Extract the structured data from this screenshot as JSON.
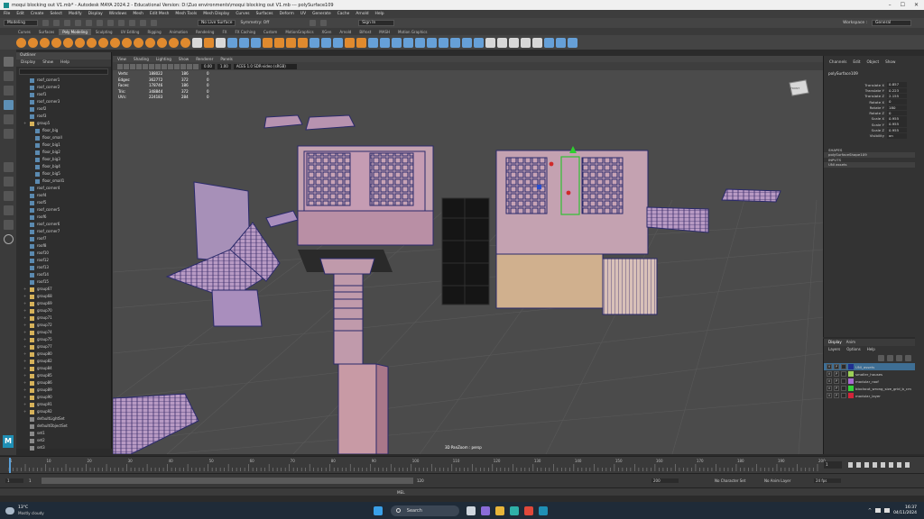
{
  "window": {
    "title": "moqui blocking out V1.mb* - Autodesk MAYA 2024.2 - Educational Version: D:\\Zuo environments\\moqui blocking out V1.mb   ---   polySurface109"
  },
  "menubar": [
    "File",
    "Edit",
    "Create",
    "Select",
    "Modify",
    "Display",
    "Windows",
    "Mesh",
    "Edit Mesh",
    "Mesh Tools",
    "Mesh Display",
    "Curves",
    "Surfaces",
    "Deform",
    "UV",
    "Generate",
    "Cache",
    "Arnold",
    "Help"
  ],
  "statusline": {
    "mode": "Modeling",
    "live_surface": "No Live Surface",
    "symmetry": "Symmetry: Off",
    "signin": "Sign In",
    "workspace_label": "Workspace :",
    "workspace": "General"
  },
  "shelf": {
    "tabs": [
      "Curves",
      "Surfaces",
      "Poly Modeling",
      "Sculpting",
      "UV Editing",
      "Rigging",
      "Animation",
      "Rendering",
      "FX",
      "FX Caching",
      "Custom",
      "MotionGraphics",
      "XGen",
      "Arnold",
      "Bifrost",
      "MASH",
      "Motion Graphics"
    ],
    "active_tab": "Poly Modeling"
  },
  "outliner": {
    "title": "Outliner",
    "menu": [
      "Display",
      "Show",
      "Help"
    ],
    "items": [
      {
        "name": "roof_corner1",
        "type": "mesh"
      },
      {
        "name": "roof_corner2",
        "type": "mesh"
      },
      {
        "name": "roof1",
        "type": "mesh"
      },
      {
        "name": "roof_corner3",
        "type": "mesh"
      },
      {
        "name": "roof2",
        "type": "mesh"
      },
      {
        "name": "roof3",
        "type": "mesh"
      },
      {
        "name": "group5",
        "type": "group"
      },
      {
        "name": "floor_big",
        "type": "mesh"
      },
      {
        "name": "floor_small",
        "type": "mesh"
      },
      {
        "name": "floor_big1",
        "type": "mesh"
      },
      {
        "name": "floor_big2",
        "type": "mesh"
      },
      {
        "name": "floor_big3",
        "type": "mesh"
      },
      {
        "name": "floor_big4",
        "type": "mesh"
      },
      {
        "name": "floor_big5",
        "type": "mesh"
      },
      {
        "name": "floor_small1",
        "type": "mesh"
      },
      {
        "name": "roof_corner4",
        "type": "mesh"
      },
      {
        "name": "roof4",
        "type": "mesh"
      },
      {
        "name": "roof5",
        "type": "mesh"
      },
      {
        "name": "roof_corner5",
        "type": "mesh"
      },
      {
        "name": "roof6",
        "type": "mesh"
      },
      {
        "name": "roof_corner6",
        "type": "mesh"
      },
      {
        "name": "roof_corner7",
        "type": "mesh"
      },
      {
        "name": "roof7",
        "type": "mesh"
      },
      {
        "name": "roof8",
        "type": "mesh"
      },
      {
        "name": "roof10",
        "type": "mesh"
      },
      {
        "name": "roof12",
        "type": "mesh"
      },
      {
        "name": "roof13",
        "type": "mesh"
      },
      {
        "name": "roof14",
        "type": "mesh"
      },
      {
        "name": "roof15",
        "type": "mesh"
      },
      {
        "name": "group67",
        "type": "group"
      },
      {
        "name": "group68",
        "type": "group"
      },
      {
        "name": "group69",
        "type": "group"
      },
      {
        "name": "group70",
        "type": "group"
      },
      {
        "name": "group71",
        "type": "group"
      },
      {
        "name": "group72",
        "type": "group"
      },
      {
        "name": "group74",
        "type": "group"
      },
      {
        "name": "group75",
        "type": "group"
      },
      {
        "name": "group77",
        "type": "group"
      },
      {
        "name": "group80",
        "type": "group"
      },
      {
        "name": "group82",
        "type": "group"
      },
      {
        "name": "group84",
        "type": "group"
      },
      {
        "name": "group85",
        "type": "group"
      },
      {
        "name": "group86",
        "type": "group"
      },
      {
        "name": "group89",
        "type": "group"
      },
      {
        "name": "group90",
        "type": "group"
      },
      {
        "name": "group91",
        "type": "group"
      },
      {
        "name": "group92",
        "type": "group"
      },
      {
        "name": "defaultLightSet",
        "type": "set"
      },
      {
        "name": "defaultObjectSet",
        "type": "set"
      },
      {
        "name": "set1",
        "type": "set"
      },
      {
        "name": "set2",
        "type": "set"
      },
      {
        "name": "set3",
        "type": "set"
      }
    ]
  },
  "viewport": {
    "menu": [
      "View",
      "Shading",
      "Lighting",
      "Show",
      "Renderer",
      "Panels"
    ],
    "exposure": "0.00",
    "gamma": "1.00",
    "colorspace": "ACES 1.0 SDR-video (sRGB)",
    "camera_label": "3D PanZoom : persp",
    "viewcube_label": "FRONT",
    "hud": [
      {
        "label": "Verts:",
        "a": "188022",
        "b": "186",
        "c": "0"
      },
      {
        "label": "Edges:",
        "a": "362772",
        "b": "372",
        "c": "0"
      },
      {
        "label": "Faces:",
        "a": "178746",
        "b": "186",
        "c": "0"
      },
      {
        "label": "Tris:",
        "a": "348844",
        "b": "372",
        "c": "0"
      },
      {
        "label": "UVs:",
        "a": "224183",
        "b": "284",
        "c": "0"
      }
    ]
  },
  "channelbox": {
    "menu": [
      "Channels",
      "Edit",
      "Object",
      "Show"
    ],
    "object": "polySurface109",
    "attrs": [
      {
        "name": "Translate X",
        "value": "0.857"
      },
      {
        "name": "Translate Y",
        "value": "0.223"
      },
      {
        "name": "Translate Z",
        "value": "2.155"
      },
      {
        "name": "Rotate X",
        "value": "0"
      },
      {
        "name": "Rotate Y",
        "value": "180"
      },
      {
        "name": "Rotate Z",
        "value": "0"
      },
      {
        "name": "Scale X",
        "value": "0.955"
      },
      {
        "name": "Scale Y",
        "value": "0.955"
      },
      {
        "name": "Scale Z",
        "value": "0.955"
      },
      {
        "name": "Visibility",
        "value": "on"
      }
    ],
    "shapes_label": "SHAPES",
    "shape": "polySurfaceShape109",
    "inputs_label": "INPUTS",
    "input": "UNI assets"
  },
  "layers": {
    "tabs": [
      "Display",
      "Anim"
    ],
    "menu": [
      "Layers",
      "Options",
      "Help"
    ],
    "items": [
      {
        "name": "UNI_assets",
        "color": "#1f2f8f",
        "selected": true
      },
      {
        "name": "smaller_houses",
        "color": "#9ccf58",
        "selected": false
      },
      {
        "name": "modular_roof",
        "color": "#a66ad0",
        "selected": false
      },
      {
        "name": "blockout_wrong_size_grid_b_cm",
        "color": "#35d23a",
        "selected": false
      },
      {
        "name": "modular_layer",
        "color": "#d2253a",
        "selected": false
      }
    ]
  },
  "timeline": {
    "ticks": [
      "1",
      "10",
      "20",
      "30",
      "40",
      "50",
      "60",
      "70",
      "80",
      "90",
      "100",
      "110",
      "120",
      "130",
      "140",
      "150",
      "160",
      "170",
      "180",
      "190",
      "200"
    ],
    "current_frame": "1"
  },
  "range": {
    "start": "1",
    "start_inner": "1",
    "end_inner": "120",
    "end": "200",
    "char_set": "No Character Set",
    "anim_layer": "No Anim Layer",
    "fps": "24 fps"
  },
  "cmdline": {
    "lang": "MEL"
  },
  "taskbar": {
    "temperature": "13°C",
    "weather": "Mostly cloudy",
    "search": "Search",
    "time": "16:37",
    "date": "04/11/2024"
  }
}
